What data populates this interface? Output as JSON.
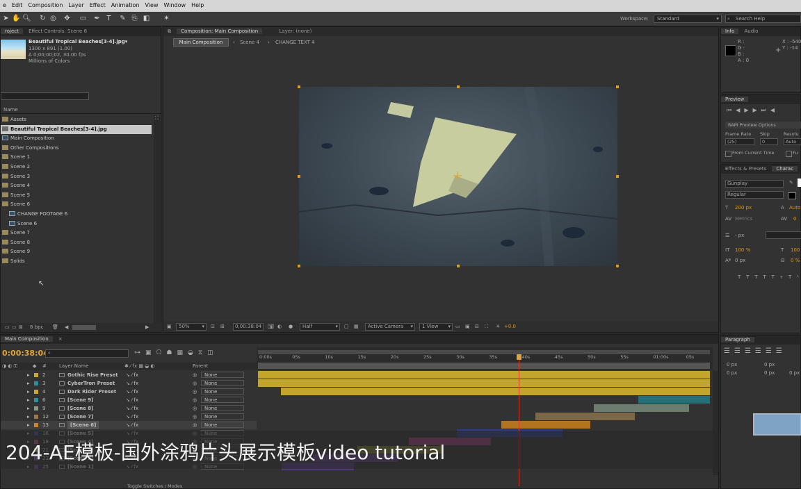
{
  "menu": [
    "e",
    "Edit",
    "Composition",
    "Layer",
    "Effect",
    "Animation",
    "View",
    "Window",
    "Help"
  ],
  "workspace": {
    "label": "Workspace:",
    "value": "Standard",
    "search_placeholder": "Search Help"
  },
  "project": {
    "tabs": [
      "roject",
      "Effect Controls: Scene 6"
    ],
    "asset_name": "Beautiful Tropical Beaches[3-4].jpg▾",
    "asset_info": [
      "1300 x 891 (1.00)",
      "Δ 0;00;00;02, 30.00 fps",
      "Millions of Colors"
    ],
    "column_name": "Name",
    "items": [
      {
        "label": "Assets",
        "type": "folder",
        "indent": 0,
        "selected": false
      },
      {
        "label": "Beautiful Tropical Beaches[3-4].jpg",
        "type": "image",
        "indent": 0,
        "selected": true
      },
      {
        "label": "Main Composition",
        "type": "comp",
        "indent": 0,
        "selected": false
      },
      {
        "label": "Other Compositions",
        "type": "folder",
        "indent": 0,
        "selected": false
      },
      {
        "label": "Scene 1",
        "type": "folder",
        "indent": 0,
        "selected": false
      },
      {
        "label": "Scene 2",
        "type": "folder",
        "indent": 0,
        "selected": false
      },
      {
        "label": "Scene 3",
        "type": "folder",
        "indent": 0,
        "selected": false
      },
      {
        "label": "Scene 4",
        "type": "folder",
        "indent": 0,
        "selected": false
      },
      {
        "label": "Scene 5",
        "type": "folder",
        "indent": 0,
        "selected": false
      },
      {
        "label": "Scene 6",
        "type": "folder",
        "indent": 0,
        "selected": false
      },
      {
        "label": "CHANGE FOOTAGE 6",
        "type": "comp",
        "indent": 1,
        "selected": false
      },
      {
        "label": "Scene 6",
        "type": "comp",
        "indent": 1,
        "selected": false
      },
      {
        "label": "Scene 7",
        "type": "folder",
        "indent": 0,
        "selected": false
      },
      {
        "label": "Scene 8",
        "type": "folder",
        "indent": 0,
        "selected": false
      },
      {
        "label": "Scene 9",
        "type": "folder",
        "indent": 0,
        "selected": false
      },
      {
        "label": "Solids",
        "type": "folder",
        "indent": 0,
        "selected": false
      }
    ],
    "bpc": "8 bpc"
  },
  "composition": {
    "tabs": [
      "Composition: Main Composition",
      "Layer: (none)"
    ],
    "breadcrumbs": [
      "Main Composition",
      "Scene 4",
      "CHANGE TEXT 4"
    ],
    "zoom": "50%",
    "timecode": "0;00:38:04",
    "resolution": "Half",
    "camera": "Active Camera",
    "view": "1 View",
    "exposure": "+0.0"
  },
  "info": {
    "tabs": [
      "Info",
      "Audio"
    ],
    "channels": [
      "R :",
      "G :",
      "B :",
      "A : 0"
    ],
    "coords": [
      "X : -540",
      "Y : -14"
    ]
  },
  "preview": {
    "tab": "Preview",
    "ram_options": "RAM Preview Options",
    "frame_rate_label": "Frame Rate",
    "skip_label": "Skip",
    "resolution_label": "Resolu",
    "frame_rate_value": "(25)",
    "skip_value": "0",
    "resolution_value": "Auto",
    "from_current": "From Current Time",
    "full_label": "Fu"
  },
  "character": {
    "tabs": [
      "Effects & Presets",
      "Charac"
    ],
    "font": "Gunplay",
    "style": "Regular",
    "size": "200 px",
    "leading": "Auto",
    "kerning": "Metrics",
    "tracking": "0",
    "stroke": "- px",
    "vscale": "100 %",
    "hscale": "100",
    "baseline": "0 px",
    "tsume": "0 %"
  },
  "paragraph": {
    "tab": "Paragraph",
    "indent_values": [
      "0 px",
      "0 px",
      "0 px",
      "0 px",
      "0 px"
    ]
  },
  "timeline": {
    "tab": "Main Composition",
    "timecode": "0:00:38:04",
    "columns": {
      "layer_name": "Layer Name",
      "parent": "Parent"
    },
    "ruler": [
      "0:00s",
      "05s",
      "10s",
      "15s",
      "20s",
      "25s",
      "30s",
      "35s",
      "40s",
      "45s",
      "50s",
      "55s",
      "01:00s",
      "05s"
    ],
    "playhead_seconds": 38.1,
    "duration_seconds": 66,
    "layers": [
      {
        "num": "2",
        "name": "Gothic Rise Preset",
        "label_color": "#c9a832",
        "parent": "None",
        "bar_color": "#c3a52c",
        "start": 0,
        "end": 66,
        "selected": false
      },
      {
        "num": "3",
        "name": "CyberTron Preset",
        "label_color": "#2f8f96",
        "parent": "None",
        "bar_color": "#c3a52c",
        "start": 0,
        "end": 66,
        "selected": false
      },
      {
        "num": "4",
        "name": "Dark Rider Preset",
        "label_color": "#c9a832",
        "parent": "None",
        "bar_color": "#c3a52c",
        "start": 3.3,
        "end": 66,
        "selected": false
      },
      {
        "num": "6",
        "name": "[Scene 9]",
        "label_color": "#2f8f96",
        "parent": "None",
        "bar_color": "#266f78",
        "start": 55.5,
        "end": 66,
        "selected": false
      },
      {
        "num": "9",
        "name": "[Scene 8]",
        "label_color": "#8a9a84",
        "parent": "None",
        "bar_color": "#6c7d6d",
        "start": 49,
        "end": 63,
        "selected": false
      },
      {
        "num": "12",
        "name": "[Scene 7]",
        "label_color": "#9a7a4a",
        "parent": "None",
        "bar_color": "#7a6848",
        "start": 40.5,
        "end": 55,
        "selected": false
      },
      {
        "num": "13",
        "name": "[Scene 6]",
        "label_color": "#c9842a",
        "parent": "None",
        "bar_color": "#b3741f",
        "start": 35.5,
        "end": 48.5,
        "selected": true
      },
      {
        "num": "16",
        "name": "[Scene 5]",
        "label_color": "#3a4a9a",
        "parent": "None",
        "bar_color": "#2e3c86",
        "start": 29,
        "end": 44.5,
        "selected": false
      },
      {
        "num": "18",
        "name": "[Scene 4]",
        "label_color": "#a04a7a",
        "parent": "None",
        "bar_color": "#8a3f6c",
        "start": 22,
        "end": 34,
        "selected": false
      },
      {
        "num": "21",
        "name": "[Scene 3]",
        "label_color": "#8a8a3a",
        "parent": "None",
        "bar_color": "#6e6e33",
        "start": 14.5,
        "end": 27,
        "selected": false
      },
      {
        "num": "23",
        "name": "[Scene 2]",
        "label_color": "#7a4a9a",
        "parent": "None",
        "bar_color": "#5e3d7c",
        "start": 8,
        "end": 20.5,
        "selected": false
      },
      {
        "num": "25",
        "name": "[Scene 1]",
        "label_color": "#6a4a9a",
        "parent": "None",
        "bar_color": "#4e3a78",
        "start": 3.5,
        "end": 14,
        "selected": false
      }
    ],
    "bottom_label": "Toggle Switches / Modes"
  },
  "subtitle": "204-AE模板-国外涂鸦片头展示模板video tutorial"
}
